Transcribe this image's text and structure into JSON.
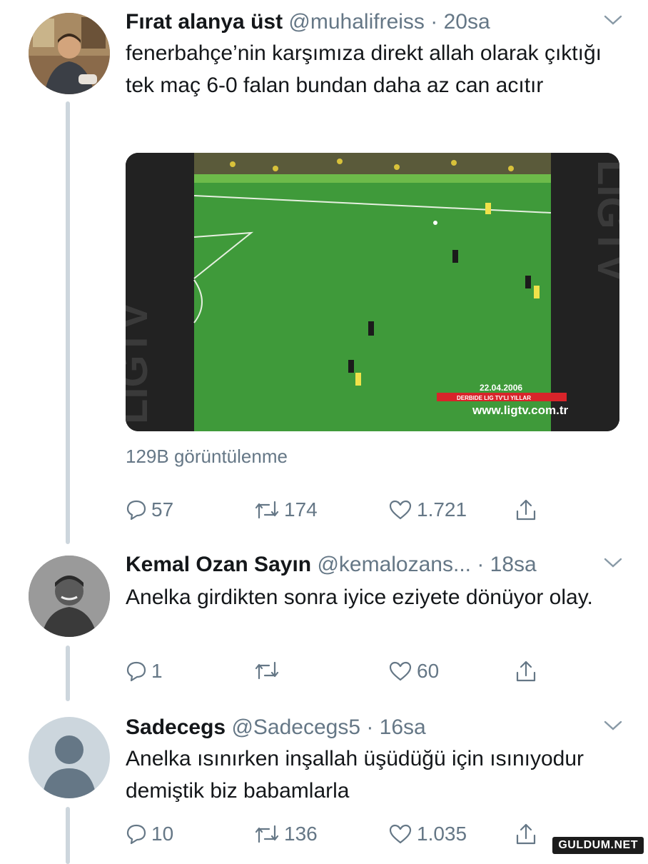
{
  "tweets": [
    {
      "name": "Fırat alanya üst",
      "handle": "@muhalifreiss",
      "time": "· 20sa",
      "text": "fenerbahçe’nin karşımıza direkt allah olarak çıktığı tek maç 6-0 falan bundan daha az can acıtır",
      "views": "129B görüntülenme",
      "media": {
        "date": "22.04.2006",
        "site": "www.ligtv.com.tr",
        "banner": "DERBIDE LIG TV'LI YILLAR",
        "side_logo": "LIGTV"
      },
      "replies": "57",
      "retweets": "174",
      "likes": "1.721"
    },
    {
      "name": "Kemal Ozan Sayın",
      "handle": "@kemalozans...",
      "time": "· 18sa",
      "text": "Anelka girdikten sonra iyice eziyete dönüyor olay.",
      "replies": "1",
      "retweets": "",
      "likes": "60"
    },
    {
      "name": "Sadecegs",
      "handle": "@Sadecegs5",
      "time": "· 16sa",
      "text": "Anelka ısınırken inşallah üşüdüğü için ısınıyodur demiştik biz babamlarla",
      "replies": "10",
      "retweets": "136",
      "likes": "1.035"
    }
  ],
  "icons": [
    "reply-icon",
    "retweet-icon",
    "like-icon",
    "share-icon",
    "chevron-down-icon"
  ],
  "colors": {
    "secondary_text": "#657786",
    "thread_line": "#cdd6dd",
    "pitch": "#3f9a3a"
  },
  "watermark": "GULDUM.NET"
}
